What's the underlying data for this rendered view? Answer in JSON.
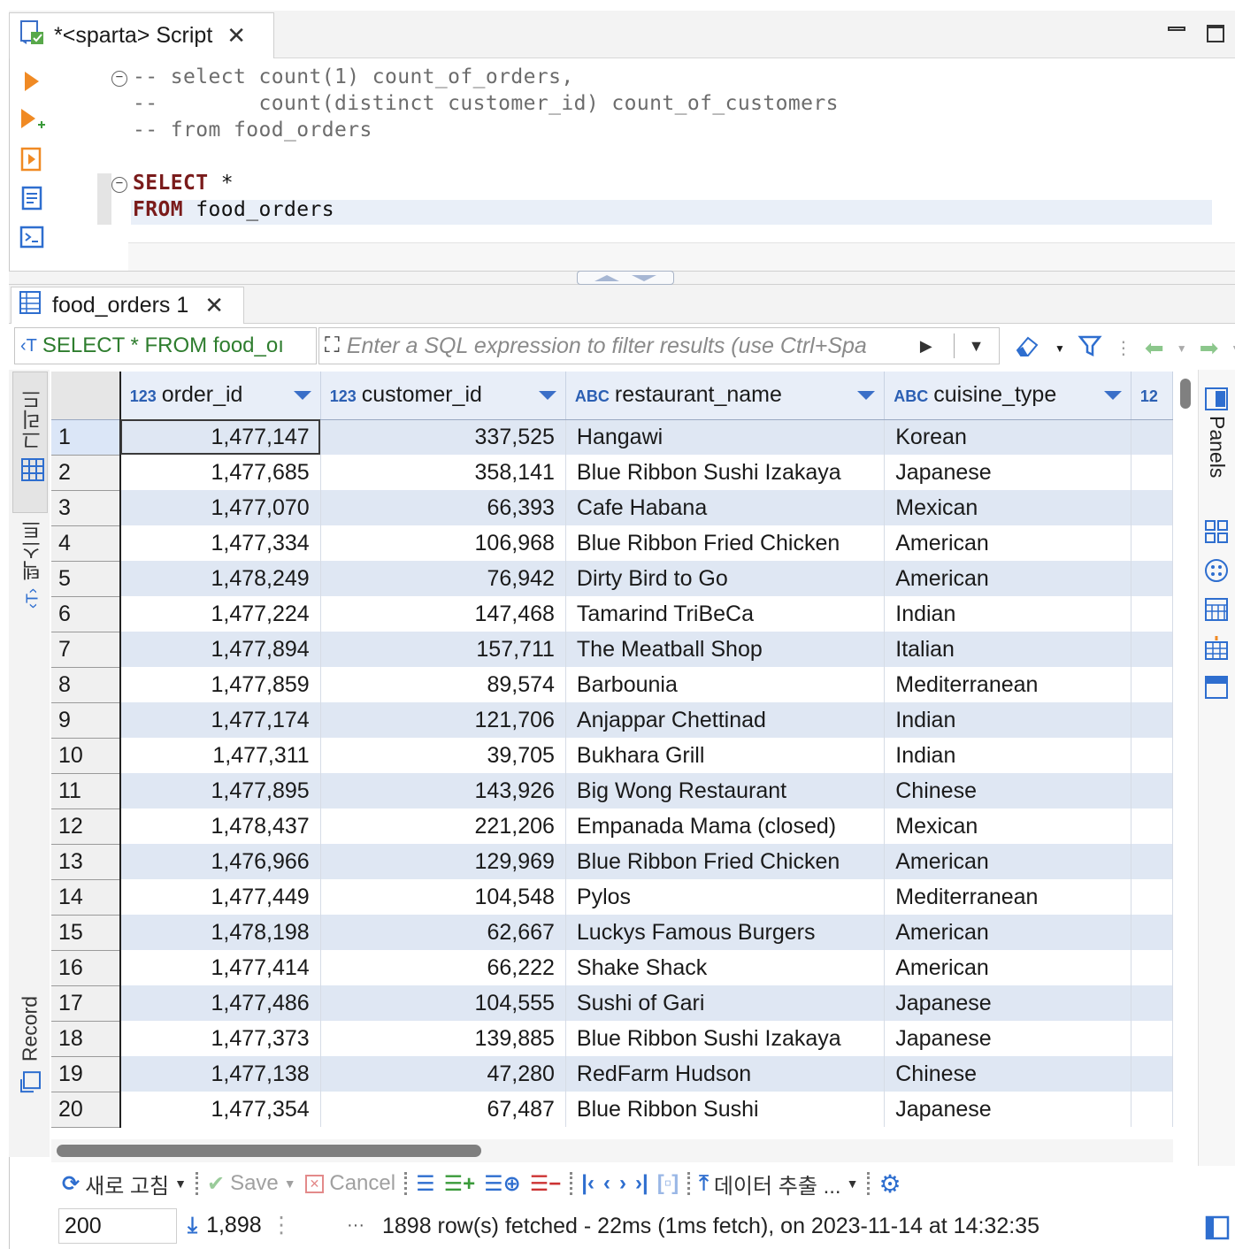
{
  "script_tab": {
    "title": "*<sparta> Script"
  },
  "editor": {
    "lines": [
      "-- select count(1) count_of_orders,",
      "--        count(distinct customer_id) count_of_customers",
      "-- from food_orders"
    ],
    "select_kw": "SELECT",
    "select_rest": " *",
    "from_kw": "FROM",
    "from_rest": " food_orders"
  },
  "results_tab": {
    "title": "food_orders 1"
  },
  "filter": {
    "query": "SELECT * FROM food_oı",
    "placeholder": "Enter a SQL expression to filter results (use Ctrl+Spa"
  },
  "side_tabs": {
    "grid": "그리드",
    "text": "텍스트",
    "record": "Record"
  },
  "right_panel": {
    "label": "Panels"
  },
  "grid": {
    "columns": [
      {
        "type": "123",
        "name": "order_id"
      },
      {
        "type": "123",
        "name": "customer_id"
      },
      {
        "type": "ABC",
        "name": "restaurant_name"
      },
      {
        "type": "ABC",
        "name": "cuisine_type"
      },
      {
        "type": "12",
        "name": ""
      }
    ],
    "rows": [
      [
        "1",
        "1,477,147",
        "337,525",
        "Hangawi",
        "Korean"
      ],
      [
        "2",
        "1,477,685",
        "358,141",
        "Blue Ribbon Sushi Izakaya",
        "Japanese"
      ],
      [
        "3",
        "1,477,070",
        "66,393",
        "Cafe Habana",
        "Mexican"
      ],
      [
        "4",
        "1,477,334",
        "106,968",
        "Blue Ribbon Fried Chicken",
        "American"
      ],
      [
        "5",
        "1,478,249",
        "76,942",
        "Dirty Bird to Go",
        "American"
      ],
      [
        "6",
        "1,477,224",
        "147,468",
        "Tamarind TriBeCa",
        "Indian"
      ],
      [
        "7",
        "1,477,894",
        "157,711",
        "The Meatball Shop",
        "Italian"
      ],
      [
        "8",
        "1,477,859",
        "89,574",
        "Barbounia",
        "Mediterranean"
      ],
      [
        "9",
        "1,477,174",
        "121,706",
        "Anjappar Chettinad",
        "Indian"
      ],
      [
        "10",
        "1,477,311",
        "39,705",
        "Bukhara Grill",
        "Indian"
      ],
      [
        "11",
        "1,477,895",
        "143,926",
        "Big Wong Restaurant",
        "Chinese"
      ],
      [
        "12",
        "1,478,437",
        "221,206",
        "Empanada Mama (closed)",
        "Mexican"
      ],
      [
        "13",
        "1,476,966",
        "129,969",
        "Blue Ribbon Fried Chicken",
        "American"
      ],
      [
        "14",
        "1,477,449",
        "104,548",
        "Pylos",
        "Mediterranean"
      ],
      [
        "15",
        "1,478,198",
        "62,667",
        "Luckys Famous Burgers",
        "American"
      ],
      [
        "16",
        "1,477,414",
        "66,222",
        "Shake Shack",
        "American"
      ],
      [
        "17",
        "1,477,486",
        "104,555",
        "Sushi of Gari",
        "Japanese"
      ],
      [
        "18",
        "1,477,373",
        "139,885",
        "Blue Ribbon Sushi Izakaya",
        "Japanese"
      ],
      [
        "19",
        "1,477,138",
        "47,280",
        "RedFarm Hudson",
        "Chinese"
      ],
      [
        "20",
        "1,477,354",
        "67,487",
        "Blue Ribbon Sushi",
        "Japanese"
      ]
    ]
  },
  "toolbar": {
    "refresh": "새로 고침",
    "save": "Save",
    "cancel": "Cancel",
    "export": "데이터 추출 ..."
  },
  "status": {
    "max_rows": "200",
    "row_count": "1,898",
    "ellipsis": "···",
    "message": "1898 row(s) fetched - 22ms (1ms fetch), on 2023-11-14 at 14:32:35"
  },
  "colors": {
    "accent": "#2e6ecf",
    "keyword": "#7a1b1b",
    "query_green": "#2e7d2e",
    "row_stripe": "#dfe7f3",
    "header_bg": "#e8eef8"
  }
}
